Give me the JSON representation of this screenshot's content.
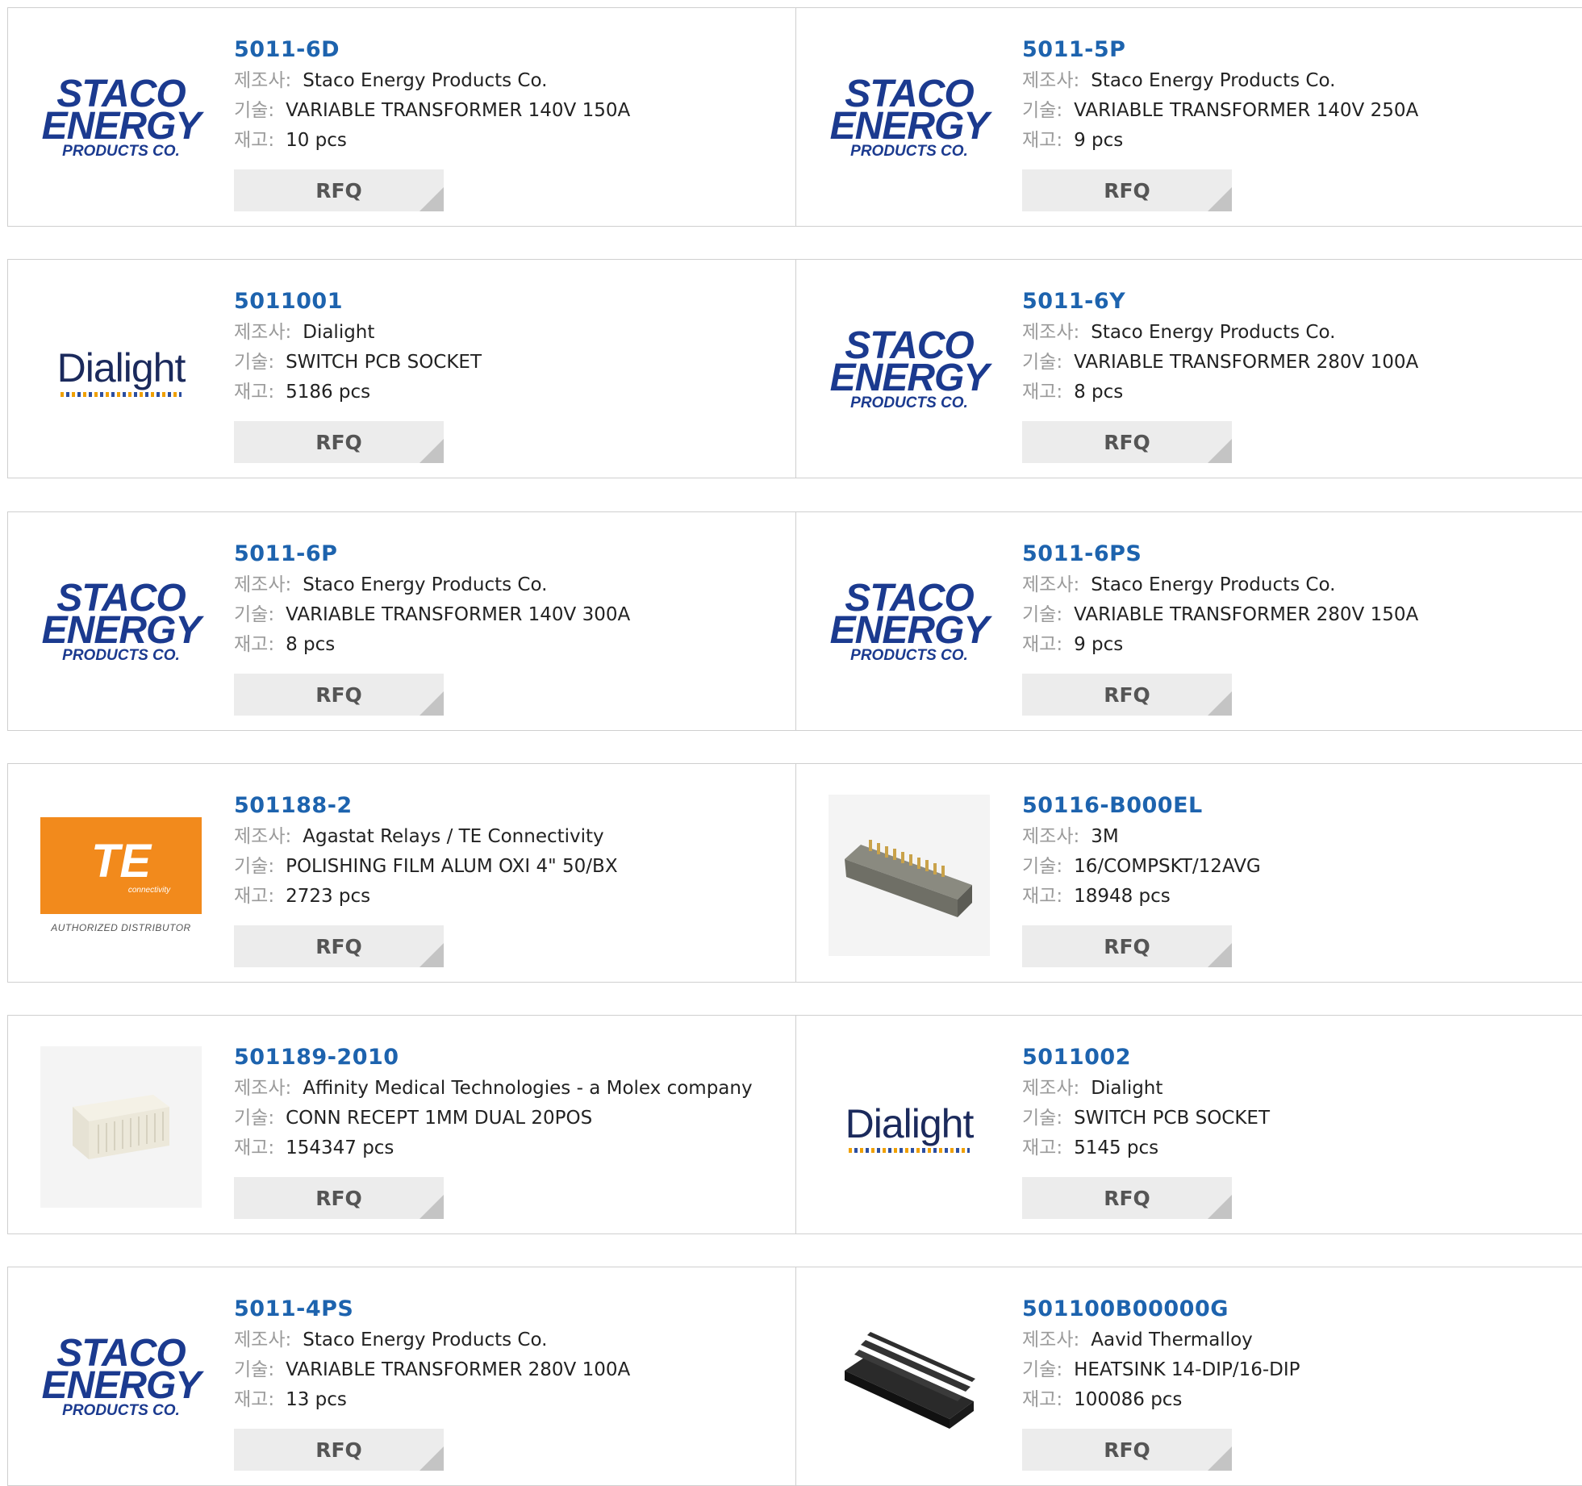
{
  "labels": {
    "manufacturer": "제조사:",
    "description": "기술:",
    "stock": "재고:",
    "rfq": "RFQ"
  },
  "logos": {
    "staco": {
      "line1": "STACO",
      "line2": "ENERGY",
      "line3": "PRODUCTS CO."
    },
    "dialight": {
      "word": "Dialight"
    },
    "te": {
      "word": "TE",
      "sub": "connectivity",
      "auth": "AUTHORIZED DISTRIBUTOR"
    }
  },
  "products": [
    {
      "pn": "5011-6D",
      "manufacturer": "Staco Energy Products Co.",
      "description": "VARIABLE TRANSFORMER 140V 150A",
      "stock": "10 pcs",
      "logo": "staco"
    },
    {
      "pn": "5011-5P",
      "manufacturer": "Staco Energy Products Co.",
      "description": "VARIABLE TRANSFORMER 140V 250A",
      "stock": "9 pcs",
      "logo": "staco"
    },
    {
      "pn": "5011001",
      "manufacturer": "Dialight",
      "description": "SWITCH PCB SOCKET",
      "stock": "5186 pcs",
      "logo": "dialight"
    },
    {
      "pn": "5011-6Y",
      "manufacturer": "Staco Energy Products Co.",
      "description": "VARIABLE TRANSFORMER 280V 100A",
      "stock": "8 pcs",
      "logo": "staco"
    },
    {
      "pn": "5011-6P",
      "manufacturer": "Staco Energy Products Co.",
      "description": "VARIABLE TRANSFORMER 140V 300A",
      "stock": "8 pcs",
      "logo": "staco"
    },
    {
      "pn": "5011-6PS",
      "manufacturer": "Staco Energy Products Co.",
      "description": "VARIABLE TRANSFORMER 280V 150A",
      "stock": "9 pcs",
      "logo": "staco"
    },
    {
      "pn": "501188-2",
      "manufacturer": "Agastat Relays / TE Connectivity",
      "description": "POLISHING FILM ALUM OXI 4\" 50/BX",
      "stock": "2723 pcs",
      "logo": "te"
    },
    {
      "pn": "50116-B000EL",
      "manufacturer": "3M",
      "description": "16/COMPSKT/12AVG",
      "stock": "18948 pcs",
      "logo": "connector"
    },
    {
      "pn": "501189-2010",
      "manufacturer": "Affinity Medical Technologies - a Molex company",
      "description": "CONN RECEPT 1MM DUAL 20POS",
      "stock": "154347 pcs",
      "logo": "receptacle"
    },
    {
      "pn": "5011002",
      "manufacturer": "Dialight",
      "description": "SWITCH PCB SOCKET",
      "stock": "5145 pcs",
      "logo": "dialight"
    },
    {
      "pn": "5011-4PS",
      "manufacturer": "Staco Energy Products Co.",
      "description": "VARIABLE TRANSFORMER 280V 100A",
      "stock": "13 pcs",
      "logo": "staco"
    },
    {
      "pn": "501100B00000G",
      "manufacturer": "Aavid Thermalloy",
      "description": "HEATSINK 14-DIP/16-DIP",
      "stock": "100086 pcs",
      "logo": "heatsink"
    }
  ]
}
